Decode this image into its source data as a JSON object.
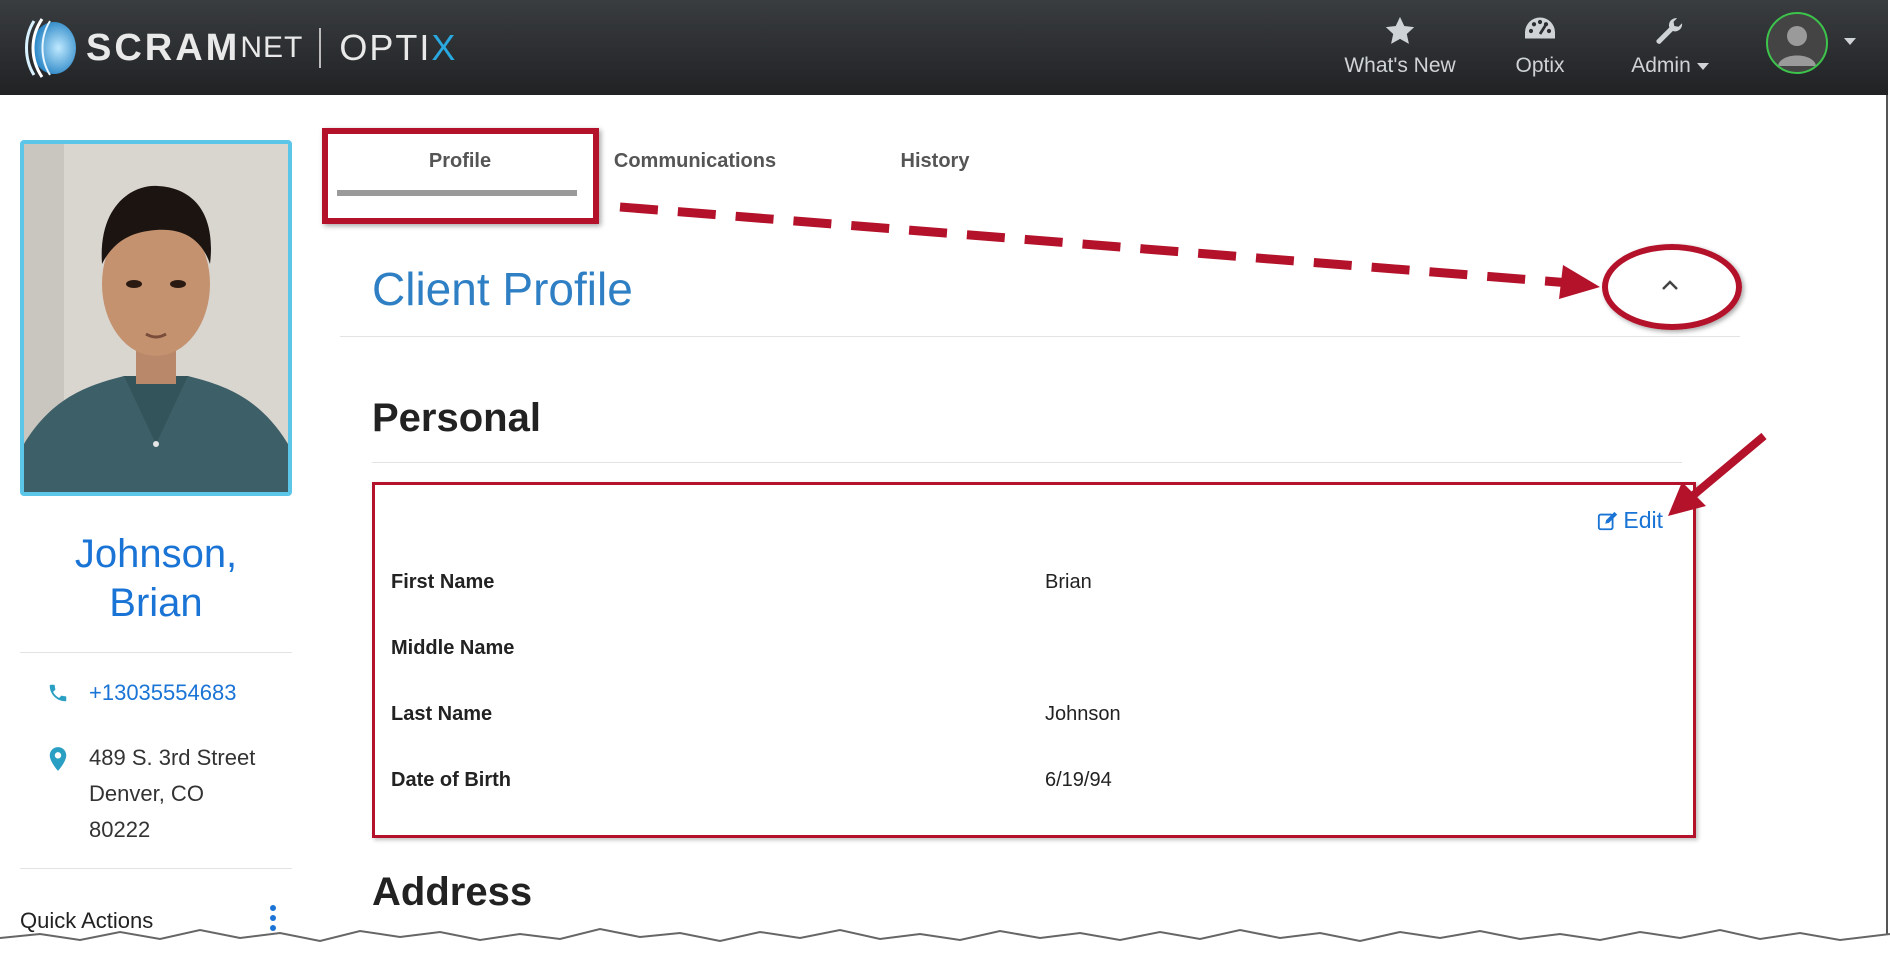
{
  "brand": {
    "scram": "SCRAM",
    "net": "NET",
    "optix_main": "OPTI",
    "optix_x": "X"
  },
  "nav": {
    "whats_new": "What's New",
    "optix": "Optix",
    "admin": "Admin"
  },
  "client": {
    "name_line1": "Johnson,",
    "name_line2": "Brian",
    "phone": "+13035554683",
    "address_line1": "489 S. 3rd Street",
    "address_line2": "Denver, CO",
    "address_line3": "80222"
  },
  "quick_actions": "Quick Actions",
  "tabs": [
    "Profile",
    "Communications",
    "History"
  ],
  "section_title": "Client Profile",
  "personal": {
    "heading": "Personal",
    "edit_label": "Edit",
    "fields": [
      {
        "label": "First Name",
        "value": "Brian"
      },
      {
        "label": "Middle Name",
        "value": ""
      },
      {
        "label": "Last Name",
        "value": "Johnson"
      },
      {
        "label": "Date of Birth",
        "value": "6/19/94"
      }
    ]
  },
  "address_heading": "Address",
  "colors": {
    "annotation": "#b3122a",
    "link": "#1a74d6",
    "title": "#2f7fc4",
    "photo_border": "#5bc6e8"
  }
}
